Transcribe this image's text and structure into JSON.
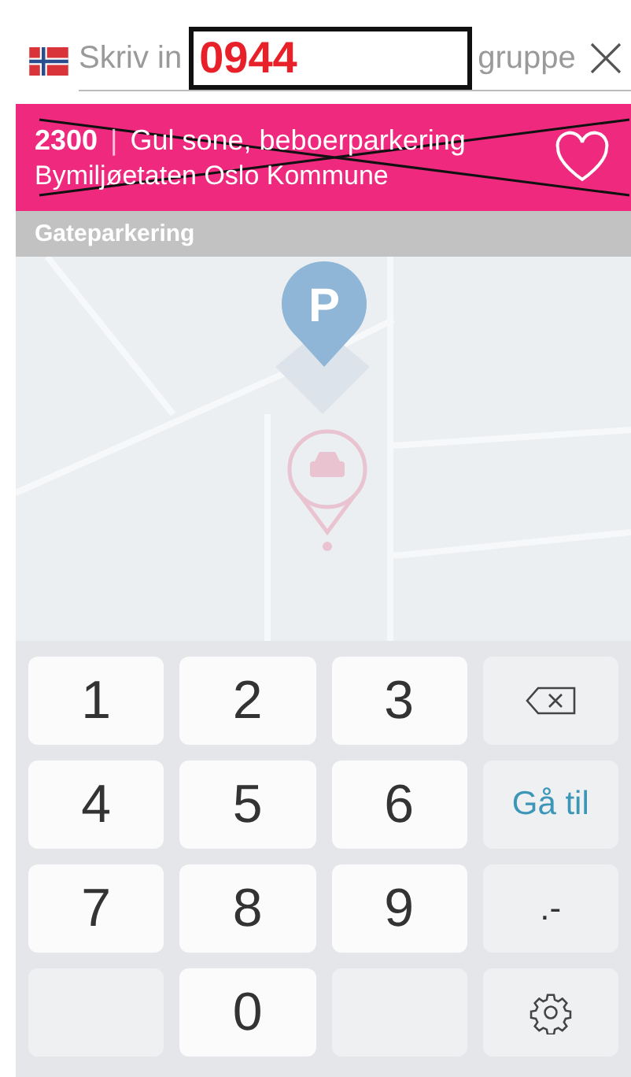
{
  "search": {
    "placeholder_start": "Skriv in",
    "placeholder_end": "gruppe",
    "annotation": "0944"
  },
  "zone": {
    "code": "2300",
    "separator": "|",
    "name": "Gul sone, beboerparkering",
    "operator": "Bymiljøetaten Oslo Kommune",
    "favorite": false,
    "crossed_out": true
  },
  "section": {
    "title": "Gateparkering"
  },
  "map": {
    "parking_marker": "P"
  },
  "keyboard": {
    "keys": [
      {
        "kind": "digit",
        "label": "1"
      },
      {
        "kind": "digit",
        "label": "2"
      },
      {
        "kind": "digit",
        "label": "3"
      },
      {
        "kind": "backspace"
      },
      {
        "kind": "digit",
        "label": "4"
      },
      {
        "kind": "digit",
        "label": "5"
      },
      {
        "kind": "digit",
        "label": "6"
      },
      {
        "kind": "action",
        "label": "Gå til"
      },
      {
        "kind": "digit",
        "label": "7"
      },
      {
        "kind": "digit",
        "label": "8"
      },
      {
        "kind": "digit",
        "label": "9"
      },
      {
        "kind": "symbol",
        "label": ".-"
      },
      {
        "kind": "blank"
      },
      {
        "kind": "digit",
        "label": "0"
      },
      {
        "kind": "blank"
      },
      {
        "kind": "settings"
      }
    ]
  }
}
